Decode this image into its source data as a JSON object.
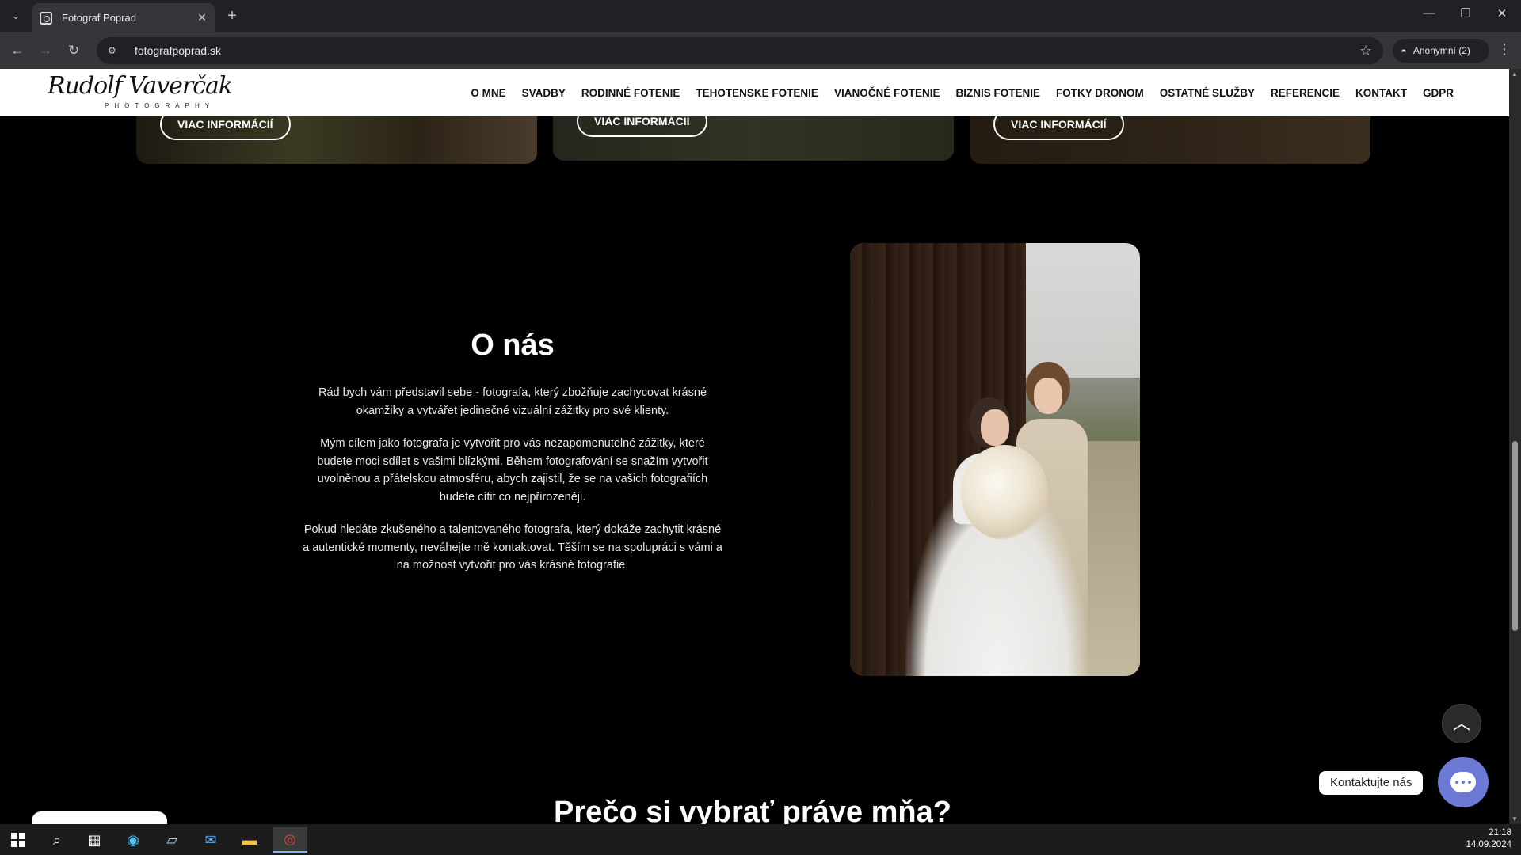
{
  "browser": {
    "tab_title": "Fotograf Poprad",
    "tab_close": "✕",
    "new_tab": "+",
    "url": "fotografpoprad.sk",
    "profile_label": "Anonymní (2)",
    "win_minimize": "—",
    "win_restore": "❐",
    "win_close": "✕"
  },
  "site": {
    "logo_text": "Rudolf Vaverčak",
    "logo_sub": "PHOTOGRAPHY",
    "nav": [
      "O MNE",
      "SVADBY",
      "RODINNÉ FOTENIE",
      "TEHOTENSKE FOTENIE",
      "VIANOČNÉ FOTENIE",
      "BIZNIS FOTENIE",
      "FOTKY DRONOM",
      "OSTATNÉ SLUŽBY",
      "REFERENCIE",
      "KONTAKT",
      "GDPR"
    ],
    "cards": [
      {
        "button": "VIAC INFORMÁCIÍ"
      },
      {
        "button": "VIAC INFORMÁCIÍ"
      },
      {
        "button": "VIAC INFORMÁCIÍ"
      }
    ],
    "about": {
      "title": "O nás",
      "p1": "Rád bych vám představil sebe - fotografa, který zbožňuje zachycovat krásné okamžiky a vytvářet jedinečné vizuální zážitky pro své klienty.",
      "p2": "Mým cílem jako fotografa je vytvořit pro vás nezapomenutelné zážitky, které budete moci sdílet s vašimi blízkými. Během fotografování se snažím vytvořit uvolněnou a přátelskou atmosféru, abych zajistil, že se na vašich fotografiích budete cítit co nejpřirozeněji.",
      "p3": "Pokud hledáte zkušeného a talentovaného fotografa, který dokáže zachytit krásné a autentické momenty, neváhejte mě kontaktovat. Těším se na spolupráci s vámi a na možnost vytvořit pro vás krásné fotografie."
    },
    "heading2": "Prečo si vybrať práve mňa?",
    "chat_label": "Kontaktujte nás"
  },
  "taskbar": {
    "time": "21:18",
    "date": "14.09.2024"
  }
}
